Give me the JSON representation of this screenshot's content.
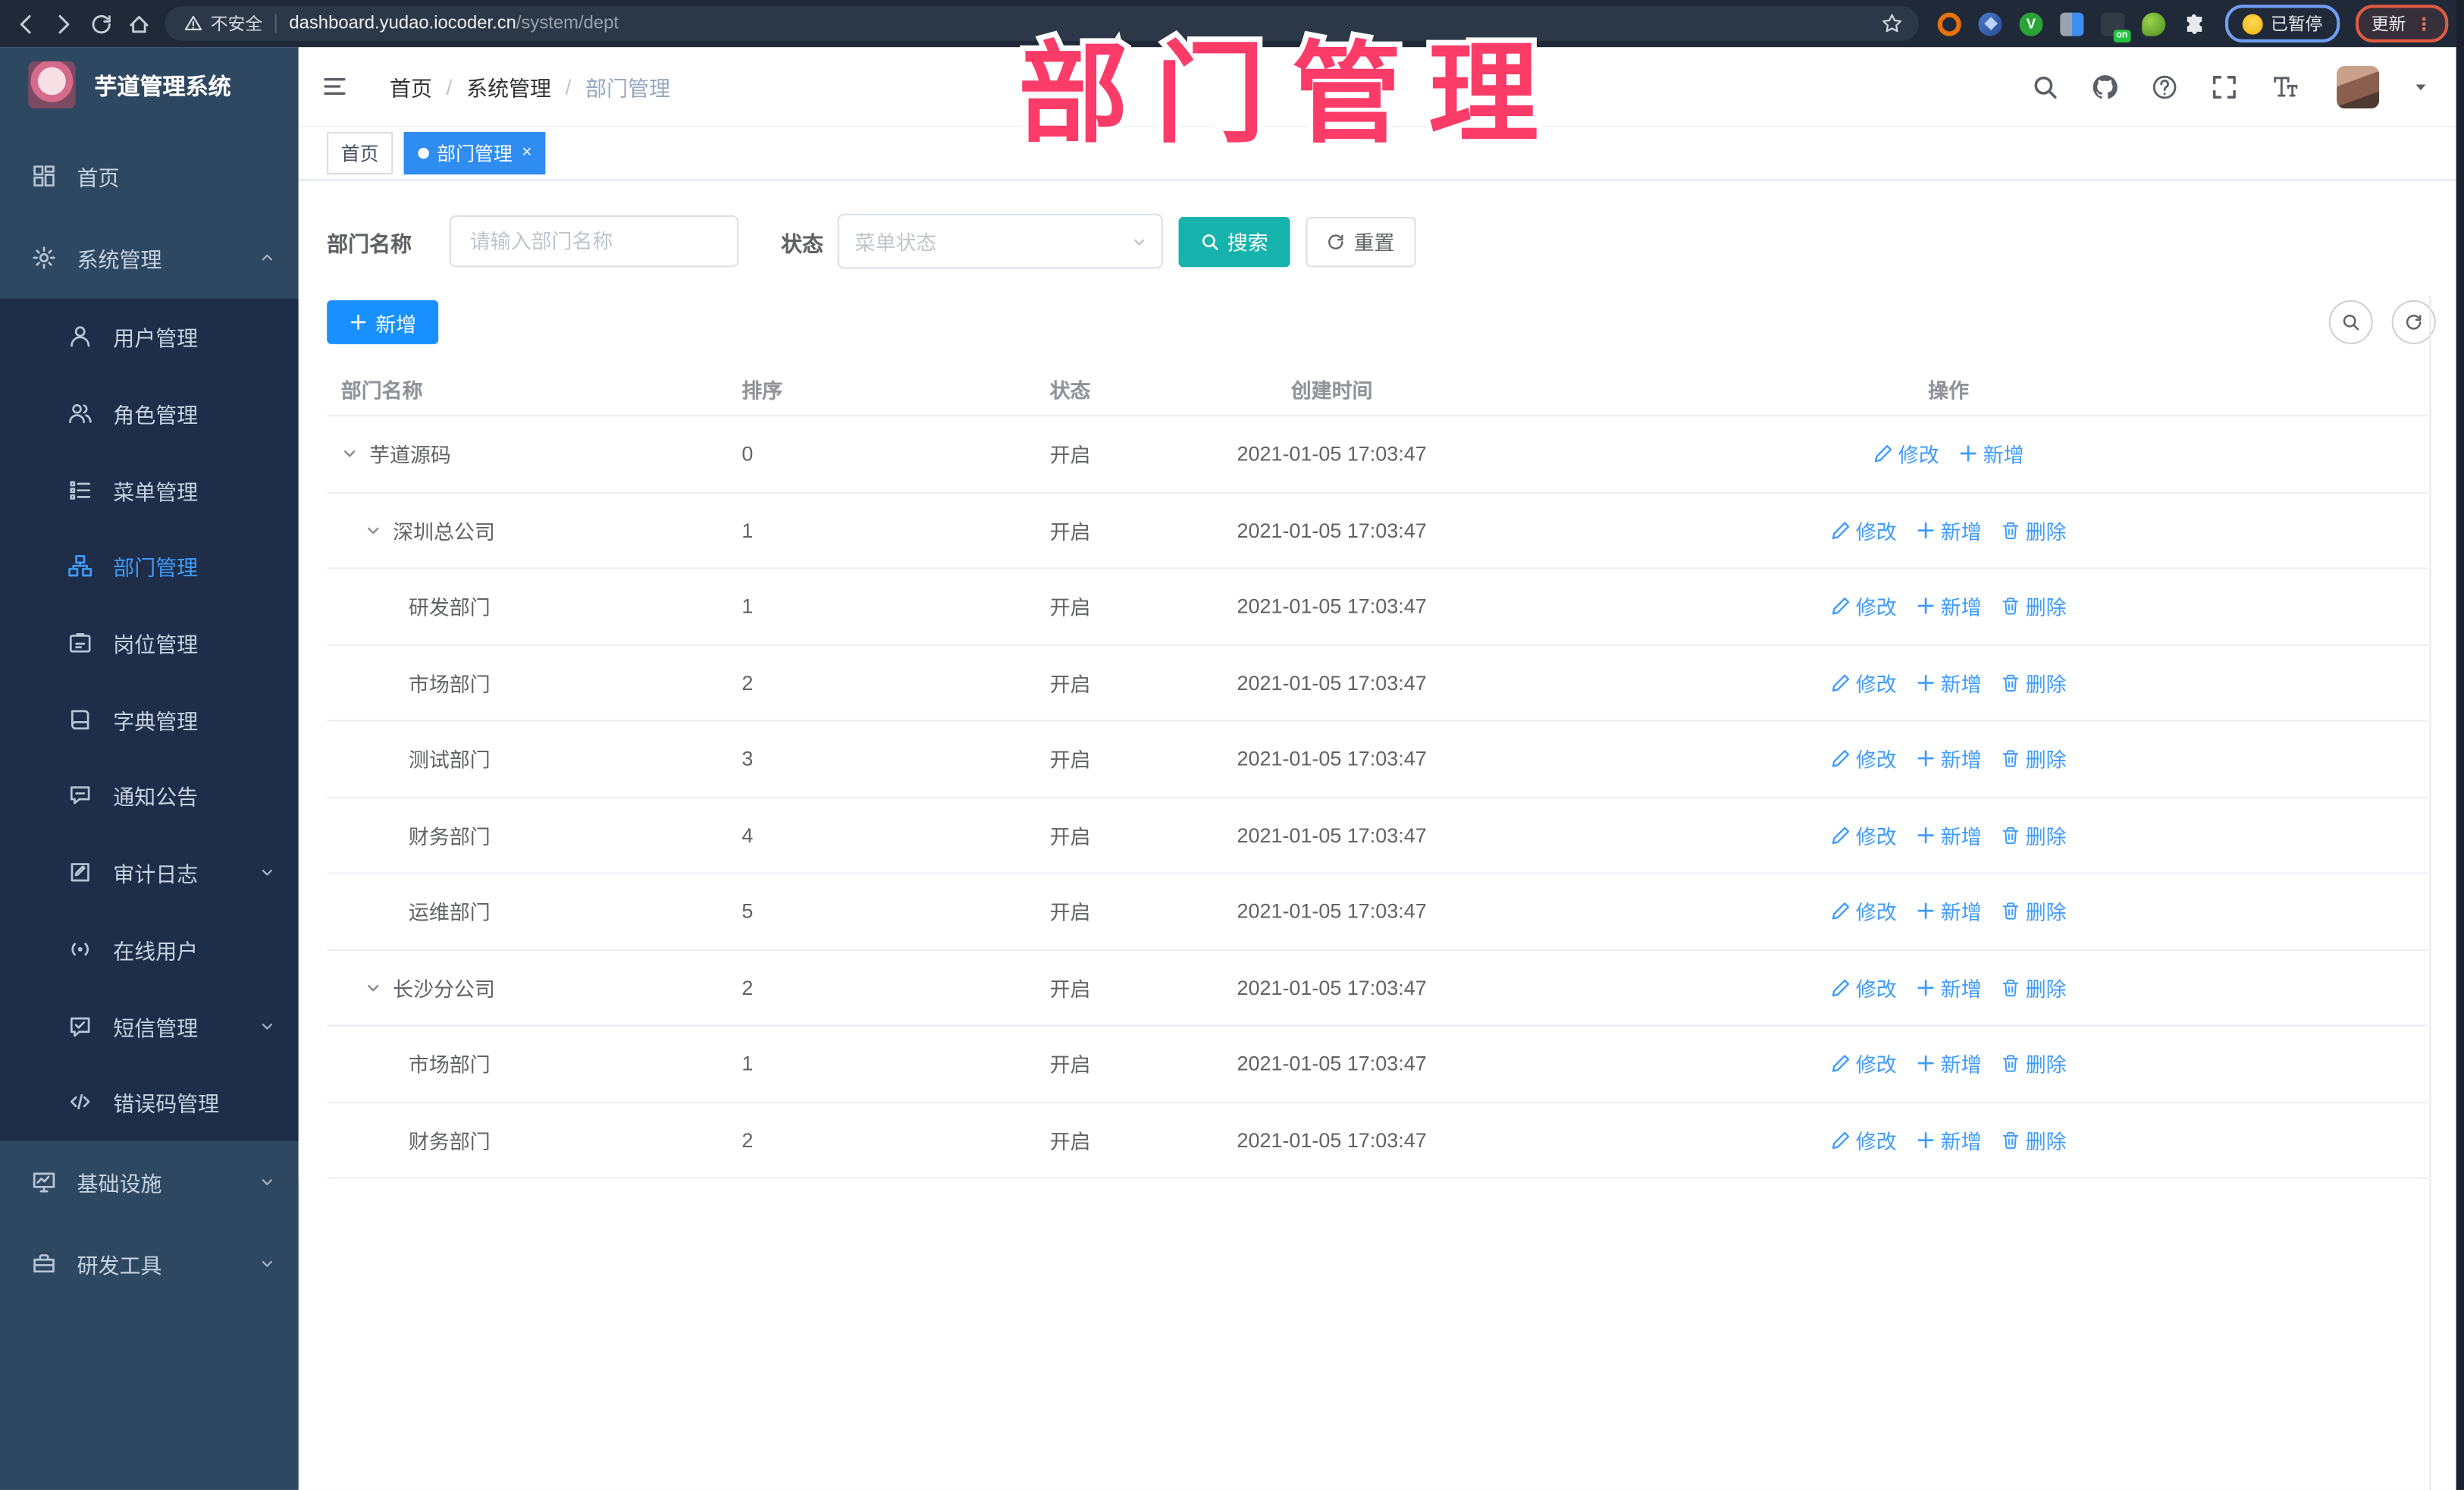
{
  "watermark": {
    "text": "部门管理",
    "color": "#fb3b68"
  },
  "browser": {
    "insecure_label": "不安全",
    "url_host": "dashboard.yudao.iocoder.cn",
    "url_path": "/system/dept",
    "paused_label": "已暂停",
    "update_label": "更新"
  },
  "sidebar": {
    "title": "芋道管理系统",
    "items": [
      {
        "id": "home",
        "label": "首页",
        "icon": "dashboard-icon",
        "type": "root"
      },
      {
        "id": "system",
        "label": "系统管理",
        "icon": "gear-icon",
        "type": "root",
        "chevron": "up"
      },
      {
        "id": "user",
        "label": "用户管理",
        "icon": "user-icon",
        "type": "sub"
      },
      {
        "id": "role",
        "label": "角色管理",
        "icon": "users-icon",
        "type": "sub"
      },
      {
        "id": "menu",
        "label": "菜单管理",
        "icon": "list-icon",
        "type": "sub"
      },
      {
        "id": "dept",
        "label": "部门管理",
        "icon": "org-tree-icon",
        "type": "sub",
        "active": true
      },
      {
        "id": "post",
        "label": "岗位管理",
        "icon": "badge-icon",
        "type": "sub"
      },
      {
        "id": "dict",
        "label": "字典管理",
        "icon": "book-icon",
        "type": "sub"
      },
      {
        "id": "notice",
        "label": "通知公告",
        "icon": "bubble-icon",
        "type": "sub"
      },
      {
        "id": "audit",
        "label": "审计日志",
        "icon": "edit-note-icon",
        "type": "sub",
        "chevron": "down"
      },
      {
        "id": "online",
        "label": "在线用户",
        "icon": "broadcast-icon",
        "type": "sub"
      },
      {
        "id": "sms",
        "label": "短信管理",
        "icon": "sms-check-icon",
        "type": "sub",
        "chevron": "down"
      },
      {
        "id": "errcode",
        "label": "错误码管理",
        "icon": "code-icon",
        "type": "sub"
      },
      {
        "id": "infra",
        "label": "基础设施",
        "icon": "monitor-icon",
        "type": "root",
        "chevron": "down"
      },
      {
        "id": "tools",
        "label": "研发工具",
        "icon": "toolbox-icon",
        "type": "root",
        "chevron": "down"
      }
    ]
  },
  "header": {
    "breadcrumb": [
      "首页",
      "系统管理",
      "部门管理"
    ]
  },
  "tabs": [
    {
      "label": "首页",
      "active": false
    },
    {
      "label": "部门管理",
      "active": true,
      "closable": true
    }
  ],
  "filters": {
    "name_label": "部门名称",
    "name_placeholder": "请输入部门名称",
    "status_label": "状态",
    "status_placeholder": "菜单状态",
    "search_label": "搜索",
    "reset_label": "重置"
  },
  "toolbar": {
    "add_label": "新增"
  },
  "actions": {
    "modify": "修改",
    "add": "新增",
    "delete": "删除"
  },
  "table": {
    "columns": [
      "部门名称",
      "排序",
      "状态",
      "创建时间",
      "操作"
    ],
    "rows": [
      {
        "name": "芋道源码",
        "level": 0,
        "expandable": true,
        "sort": "0",
        "status": "开启",
        "time": "2021-01-05 17:03:47",
        "actions": [
          "modify",
          "add"
        ]
      },
      {
        "name": "深圳总公司",
        "level": 1,
        "expandable": true,
        "sort": "1",
        "status": "开启",
        "time": "2021-01-05 17:03:47",
        "actions": [
          "modify",
          "add",
          "delete"
        ]
      },
      {
        "name": "研发部门",
        "level": 2,
        "expandable": false,
        "sort": "1",
        "status": "开启",
        "time": "2021-01-05 17:03:47",
        "actions": [
          "modify",
          "add",
          "delete"
        ]
      },
      {
        "name": "市场部门",
        "level": 2,
        "expandable": false,
        "sort": "2",
        "status": "开启",
        "time": "2021-01-05 17:03:47",
        "actions": [
          "modify",
          "add",
          "delete"
        ]
      },
      {
        "name": "测试部门",
        "level": 2,
        "expandable": false,
        "sort": "3",
        "status": "开启",
        "time": "2021-01-05 17:03:47",
        "actions": [
          "modify",
          "add",
          "delete"
        ]
      },
      {
        "name": "财务部门",
        "level": 2,
        "expandable": false,
        "sort": "4",
        "status": "开启",
        "time": "2021-01-05 17:03:47",
        "actions": [
          "modify",
          "add",
          "delete"
        ]
      },
      {
        "name": "运维部门",
        "level": 2,
        "expandable": false,
        "sort": "5",
        "status": "开启",
        "time": "2021-01-05 17:03:47",
        "actions": [
          "modify",
          "add",
          "delete"
        ]
      },
      {
        "name": "长沙分公司",
        "level": 1,
        "expandable": true,
        "sort": "2",
        "status": "开启",
        "time": "2021-01-05 17:03:47",
        "actions": [
          "modify",
          "add",
          "delete"
        ]
      },
      {
        "name": "市场部门",
        "level": 2,
        "expandable": false,
        "sort": "1",
        "status": "开启",
        "time": "2021-01-05 17:03:47",
        "actions": [
          "modify",
          "add",
          "delete"
        ]
      },
      {
        "name": "财务部门",
        "level": 2,
        "expandable": false,
        "sort": "2",
        "status": "开启",
        "time": "2021-01-05 17:03:47",
        "actions": [
          "modify",
          "add",
          "delete"
        ]
      }
    ]
  },
  "colors": {
    "sidebar_bg": "#2f4861",
    "submenu_bg": "#1e2e49",
    "active_blue": "#3f9bfa",
    "tab_active": "#2f8cf0",
    "search_teal": "#16b3ac",
    "add_blue": "#1890ff",
    "watermark_pink": "#fb3b68"
  }
}
